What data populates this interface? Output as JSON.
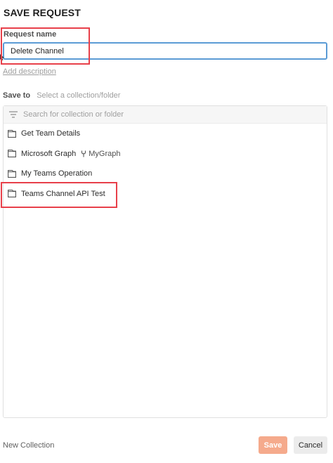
{
  "dialog": {
    "title": "SAVE REQUEST",
    "request_name_label": "Request name",
    "request_name_value": "Delete Channel",
    "add_description": "Add description",
    "save_to_label": "Save to",
    "save_to_hint": "Select a collection/folder",
    "search_placeholder": "Search for collection or folder",
    "collections": [
      {
        "label": "Get Team Details"
      },
      {
        "label": "Microsoft Graph",
        "fork": "MyGraph"
      },
      {
        "label": "My Teams Operation"
      },
      {
        "label": "Teams Channel API Test"
      }
    ],
    "new_collection": "New Collection",
    "save_button": "Save",
    "cancel_button": "Cancel"
  },
  "colors": {
    "accent_input_border": "#5b9bd5",
    "highlight": "#e8404a",
    "save_button": "#f5aa8c"
  },
  "icons": [
    "folder-icon",
    "filter-icon",
    "fork-icon"
  ]
}
